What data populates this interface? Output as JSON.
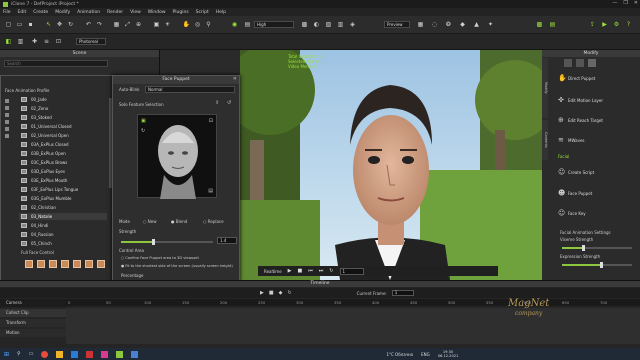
{
  "app": {
    "title": "iClone 7 - DefProject iProject *",
    "window_controls": [
      "—",
      "❐",
      "✕"
    ]
  },
  "menu": [
    "File",
    "Edit",
    "Create",
    "Modify",
    "Animation",
    "Render",
    "View",
    "Window",
    "Plugins",
    "Script",
    "Help"
  ],
  "toolbar": {
    "quality": "High",
    "preview": "Preview",
    "projection": "Photoreal"
  },
  "scene_panel": {
    "title": "Scene",
    "search_placeholder": "Search"
  },
  "face_puppet": {
    "title": "Face Puppet",
    "list_header": "Face Animation Profile",
    "auto_blink_label": "Auto-Blink",
    "auto_blink_value": "Normal",
    "solo_label": "Solo Feature Selection",
    "profiles": [
      "00_Jade",
      "02_Zeno",
      "03_Stoked",
      "01_Universal Closed",
      "02_Universal Open",
      "03A_ExPlus Closed",
      "03B_ExPlus Open",
      "03C_ExPlus Brows",
      "03D_ExPlus Eyes",
      "03E_ExPlus Mouth",
      "03F_ExPlus Lips Tongue",
      "03G_ExPlus Mumble",
      "02_Christian",
      "03_Natalie",
      "04_Hindi",
      "04_Russian",
      "05_Chinch"
    ],
    "selected_index": 13,
    "mode_label": "Mode",
    "mode_options": [
      "New",
      "Blend",
      "Replace"
    ],
    "mode_selected": "Blend",
    "strength_label": "Strength",
    "strength_value": "1.4",
    "strength_fraction": 0.35,
    "control_area_label": "Control Area",
    "control_options": [
      "Confine Face Puppet area to 3D viewport",
      "Fit to the shortest side of the screen (usually screen height)"
    ],
    "percentage_label": "Percentage",
    "percentage_value": "40",
    "percentage_fraction": 0.4,
    "full_face_label": "Full Face Control",
    "preview_label": "Preview",
    "record_label": "Record"
  },
  "viewport": {
    "overlay_lines": [
      "Total Selected: 1",
      "Selected Items: 1",
      "Video Memory"
    ],
    "realtime_label": "Realtime",
    "frame_value": "1"
  },
  "modify_panel": {
    "title": "Modify",
    "side_tabs": [
      "Modify",
      "Contents"
    ],
    "buttons": [
      "Direct Puppet",
      "Edit Motion Layer",
      "Edit Reach Target",
      "MWaves"
    ],
    "facial_label": "Facial",
    "facial_buttons": [
      "Create Script",
      "Face Puppet",
      "Face Key"
    ],
    "settings_label": "Facial Animation Settings",
    "viseme_label": "Viseme Strength",
    "viseme_fraction": 0.3,
    "expression_label": "Expression Strength",
    "expression_fraction": 0.55
  },
  "timeline": {
    "title": "Timeline",
    "current_frame_label": "Current Frame:",
    "current_frame": "1",
    "tracks": [
      "Camera",
      "Collect Clip",
      "Transform",
      "Motion"
    ],
    "ruler": [
      "0",
      "50",
      "100",
      "150",
      "200",
      "250",
      "300",
      "350",
      "400",
      "450",
      "500",
      "550",
      "600",
      "650",
      "700"
    ]
  },
  "watermark": {
    "line1": "MagNet",
    "line2": "company"
  },
  "taskbar": {
    "weather": "1°C Облачно",
    "lang": "ENG",
    "time": "19:30",
    "date": "06.12.2021"
  },
  "colors": {
    "accent": "#8dc63f",
    "record": "#d32020",
    "panel": "#2b2b2b",
    "header": "#3a3a3a"
  }
}
